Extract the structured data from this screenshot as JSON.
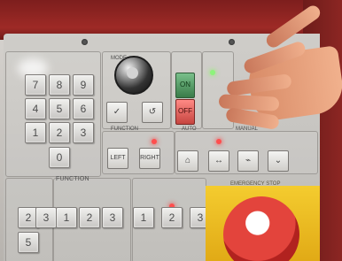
{
  "panel": {
    "numbers": [
      "1",
      "2",
      "3",
      "4",
      "5",
      "6",
      "7",
      "8",
      "9",
      "0",
      "2",
      "3",
      "1",
      "2",
      "3",
      "1",
      "2",
      "3",
      "5"
    ],
    "labels": {
      "function": "FUNCTION",
      "mode": "MODE",
      "auto": "AUTO",
      "manual": "MANUAL",
      "on": "ON",
      "off": "OFF",
      "left": "LEFT",
      "right": "RIGHT",
      "emergency": "EMERGENCY STOP"
    }
  }
}
